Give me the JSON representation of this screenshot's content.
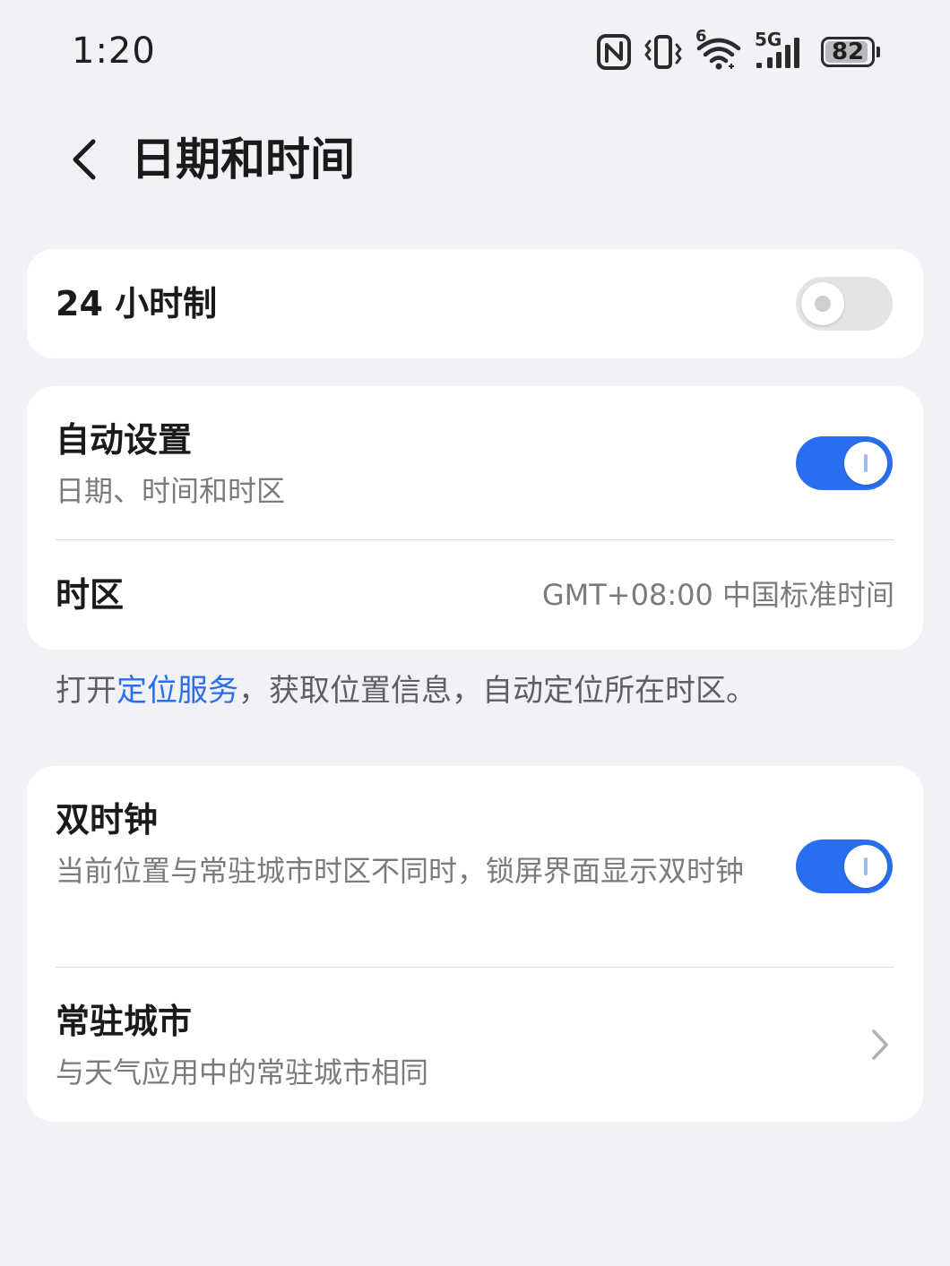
{
  "status_bar": {
    "time": "1:20",
    "network_label": "5G",
    "wifi_badge": "6",
    "battery_level": "82",
    "icons": [
      "nfc-icon",
      "vibrate-icon",
      "wifi-icon",
      "cellular-signal-icon",
      "battery-icon"
    ]
  },
  "header": {
    "title": "日期和时间"
  },
  "settings": {
    "hour24": {
      "title": "24 小时制",
      "enabled": false
    },
    "auto_set": {
      "title": "自动设置",
      "subtitle": "日期、时间和时区",
      "enabled": true
    },
    "timezone": {
      "title": "时区",
      "value": "GMT+08:00 中国标准时间"
    },
    "dual_clock": {
      "title": "双时钟",
      "subtitle": "当前位置与常驻城市时区不同时，锁屏界面显示双时钟",
      "enabled": true
    },
    "home_city": {
      "title": "常驻城市",
      "subtitle": "与天气应用中的常驻城市相同"
    }
  },
  "hint": {
    "prefix": "打开",
    "link": "定位服务",
    "suffix": "，获取位置信息，自动定位所在时区。"
  },
  "colors": {
    "background": "#f1f2f6",
    "card": "#ffffff",
    "accent": "#2a6ef0",
    "secondary_text": "#7b7b7e",
    "toggle_off": "#e4e4e6"
  }
}
